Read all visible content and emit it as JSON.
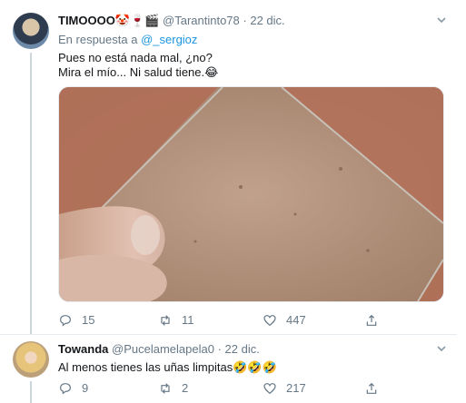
{
  "tweets": [
    {
      "display_name": "TIMOOOO🤡🍷🎬",
      "username": "@Tarantinto78",
      "date": "22 dic.",
      "reply_to_prefix": "En respuesta a",
      "reply_to_handle": "@_sergioz",
      "text_line_1": "Pues no está nada mal, ¿no?",
      "text_line_2": "Mira el mío... Ni salud tiene.😂",
      "reply_count": "15",
      "retweet_count": "11",
      "like_count": "447"
    },
    {
      "display_name": "Towanda",
      "username": "@Pucelamelapela0",
      "date": "22 dic.",
      "text": "Al menos tienes las uñas limpitas🤣🤣🤣",
      "reply_count": "9",
      "retweet_count": "2",
      "like_count": "217"
    }
  ],
  "colors": {
    "link": "#1b95e0",
    "secondary_text": "#657786",
    "divider": "#e6ecf0"
  },
  "icons": {
    "reply": "reply-icon",
    "retweet": "retweet-icon",
    "like": "heart-icon",
    "share": "share-icon",
    "more": "chevron-down-icon"
  }
}
